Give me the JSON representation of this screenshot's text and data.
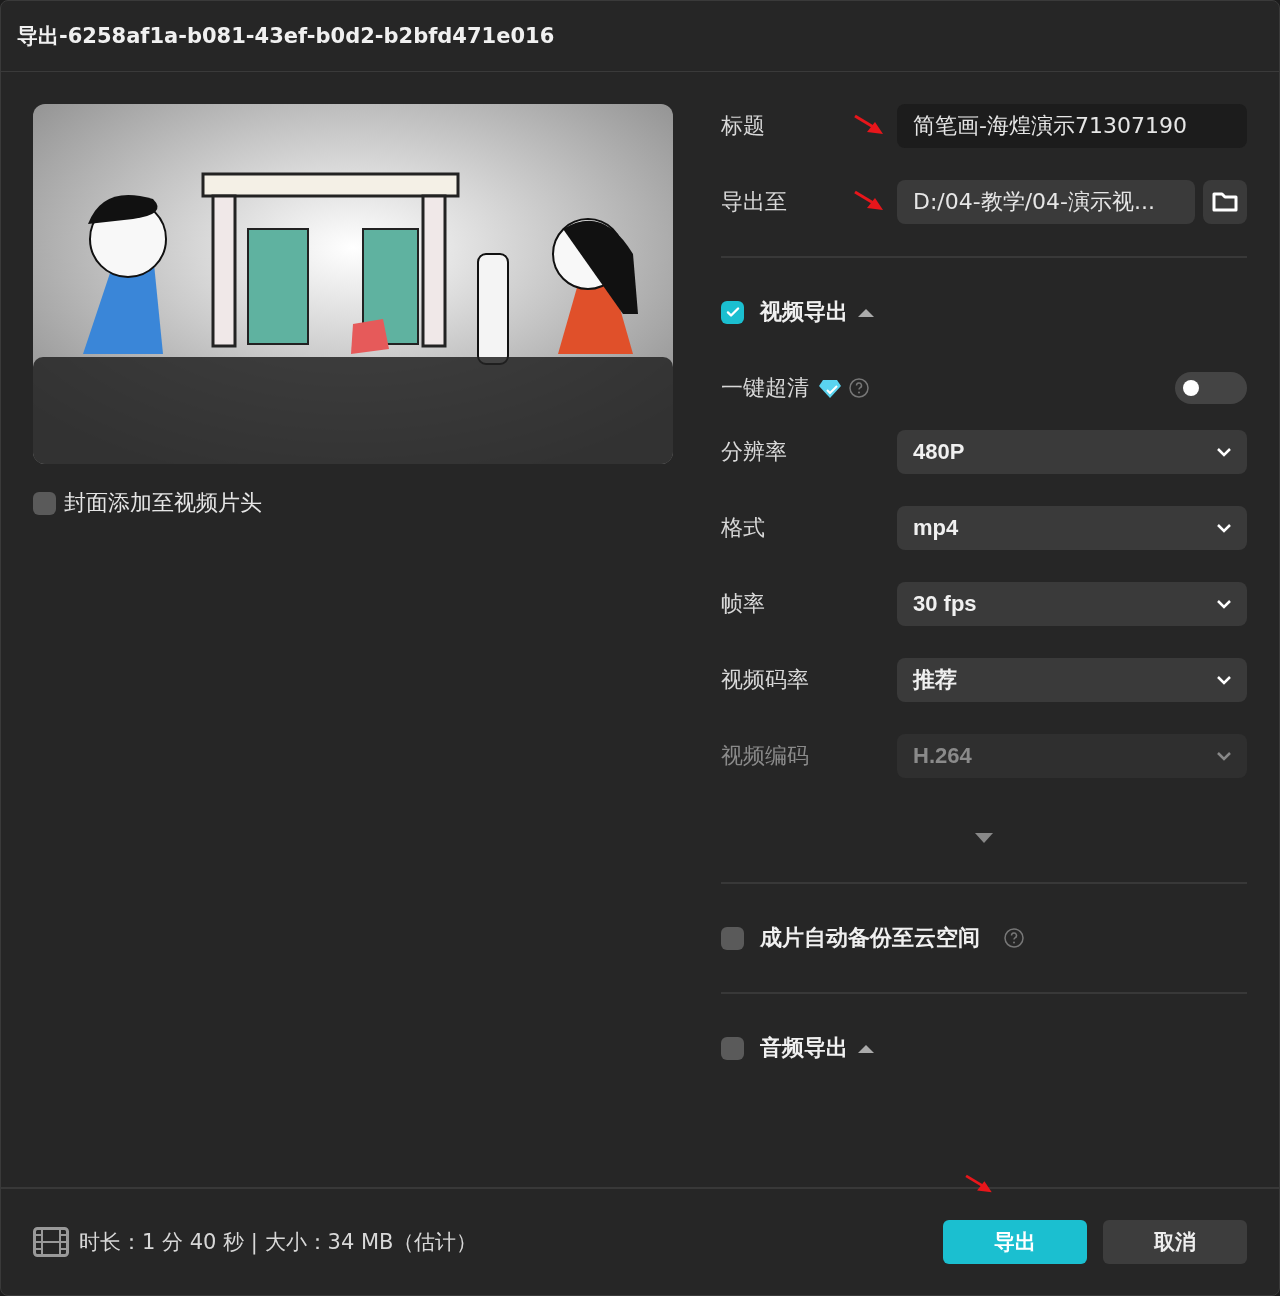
{
  "window": {
    "title": "导出-6258af1a-b081-43ef-b0d2-b2bfd471e016"
  },
  "cover_option": {
    "label": "封面添加至视频片头",
    "checked": false
  },
  "fields": [
    {
      "label": "标题",
      "value": "简笔画-海煌演示71307190",
      "kind": "text"
    },
    {
      "label": "导出至",
      "value": "D:/04-教学/04-演示视...",
      "kind": "path"
    }
  ],
  "video_export": {
    "label": "视频导出",
    "checked": true,
    "expanded": true,
    "super_resolution": {
      "label": "一键超清",
      "on": false
    },
    "settings": [
      {
        "label": "分辨率",
        "value": "480P",
        "disabled": false
      },
      {
        "label": "格式",
        "value": "mp4",
        "disabled": false
      },
      {
        "label": "帧率",
        "value": "30 fps",
        "disabled": false
      },
      {
        "label": "视频码率",
        "value": "推荐",
        "disabled": false
      },
      {
        "label": "视频编码",
        "value": "H.264",
        "disabled": true
      }
    ]
  },
  "cloud_backup": {
    "label": "成片自动备份至云空间",
    "checked": false
  },
  "audio_export": {
    "label": "音频导出",
    "checked": false,
    "expanded": true
  },
  "footer": {
    "info": "时长：1 分 40 秒 | 大小：34 MB（估计）"
  },
  "buttons": [
    {
      "label": "导出",
      "kind": "primary"
    },
    {
      "label": "取消",
      "kind": "secondary"
    }
  ]
}
